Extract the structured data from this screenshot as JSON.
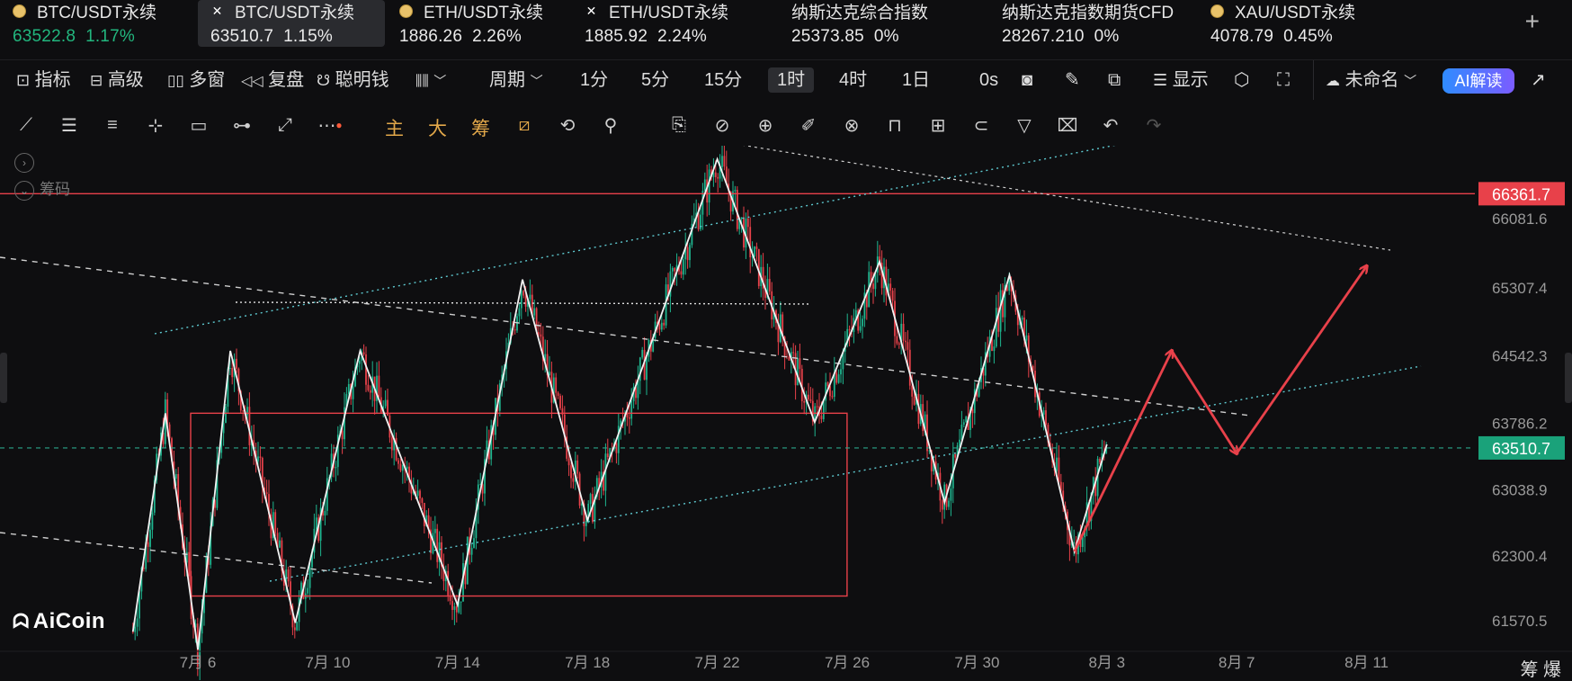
{
  "tickers": [
    {
      "name": "BTC/USDT永续",
      "price": "63522.8",
      "change": "1.17%",
      "icon": "gold-coin-icon",
      "color": "green"
    },
    {
      "name": "BTC/USDT永续",
      "price": "63510.7",
      "change": "1.15%",
      "icon": "x-exchange-icon",
      "color": "white",
      "active": true
    },
    {
      "name": "ETH/USDT永续",
      "price": "1886.26",
      "change": "2.26%",
      "icon": "gold-coin-icon",
      "color": "white"
    },
    {
      "name": "ETH/USDT永续",
      "price": "1885.92",
      "change": "2.24%",
      "icon": "x-exchange-icon",
      "color": "white"
    },
    {
      "name": "纳斯达克综合指数",
      "price": "25373.85",
      "change": "0%",
      "icon": "",
      "color": "white"
    },
    {
      "name": "纳斯达克指数期货CFD",
      "price": "28267.210",
      "change": "0%",
      "icon": "",
      "color": "white"
    },
    {
      "name": "XAU/USDT永续",
      "price": "4078.79",
      "change": "0.45%",
      "icon": "gold-coin-icon",
      "color": "white"
    }
  ],
  "toolbar": {
    "indicators": "指标",
    "advanced": "高级",
    "multiwindow": "多窗",
    "replay": "复盘",
    "smartmoney": "聪明钱",
    "period": "周期",
    "tf_1m": "1分",
    "tf_5m": "5分",
    "tf_15m": "15分",
    "tf_1h": "1时",
    "tf_4h": "4时",
    "tf_1d": "1日",
    "countdown": "0s",
    "display": "显示",
    "layout_name": "未命名",
    "ai": "AI解读"
  },
  "drawbar": {
    "main": "主",
    "big": "大",
    "chips": "筹"
  },
  "legend": {
    "chips": "筹码"
  },
  "watermark": "AiCoin",
  "bottom_right": "筹 爆",
  "colors": {
    "up": "#1fb58f",
    "down": "#e8414a",
    "accent": "#e8414a",
    "current": "#1aa27a",
    "bg": "#0e0e10"
  },
  "chart_data": {
    "type": "candlestick",
    "symbol": "BTC/USDT永续",
    "interval": "1时",
    "y_ticks": [
      "66081.6",
      "65307.4",
      "64542.3",
      "63786.2",
      "63038.9",
      "62300.4",
      "61570.5"
    ],
    "x_ticks": [
      "7月 6",
      "7月 10",
      "7月 14",
      "7月 18",
      "7月 22",
      "7月 26",
      "7月 30",
      "8月 3",
      "8月 7",
      "8月 11"
    ],
    "ylim": [
      61250,
      66900
    ],
    "current_price": "63510.7",
    "resistance_price": "66361.7",
    "zigzag": [
      {
        "t": "7月 4",
        "p": 61450
      },
      {
        "t": "7月 5",
        "p": 63900
      },
      {
        "t": "7月 6",
        "p": 61250
      },
      {
        "t": "7月 7",
        "p": 64600
      },
      {
        "t": "7月 9",
        "p": 61550
      },
      {
        "t": "7月 11",
        "p": 64600
      },
      {
        "t": "7月 14",
        "p": 61750
      },
      {
        "t": "7月 16",
        "p": 65400
      },
      {
        "t": "7月 18",
        "p": 62700
      },
      {
        "t": "7月 22",
        "p": 66750
      },
      {
        "t": "7月 25",
        "p": 63800
      },
      {
        "t": "7月 27",
        "p": 65600
      },
      {
        "t": "7月 29",
        "p": 62900
      },
      {
        "t": "7月 31",
        "p": 65450
      },
      {
        "t": "8月 2",
        "p": 62350
      },
      {
        "t": "8月 3",
        "p": 63550
      }
    ],
    "projection": [
      {
        "t": "8月 2",
        "p": 62350
      },
      {
        "t": "8月 5",
        "p": 64600
      },
      {
        "t": "8月 7",
        "p": 63450
      },
      {
        "t": "8月 11",
        "p": 65550
      }
    ],
    "box": {
      "t1": "7月 6",
      "t2": "7月 25",
      "p1": 63900,
      "p2": 61850
    }
  }
}
